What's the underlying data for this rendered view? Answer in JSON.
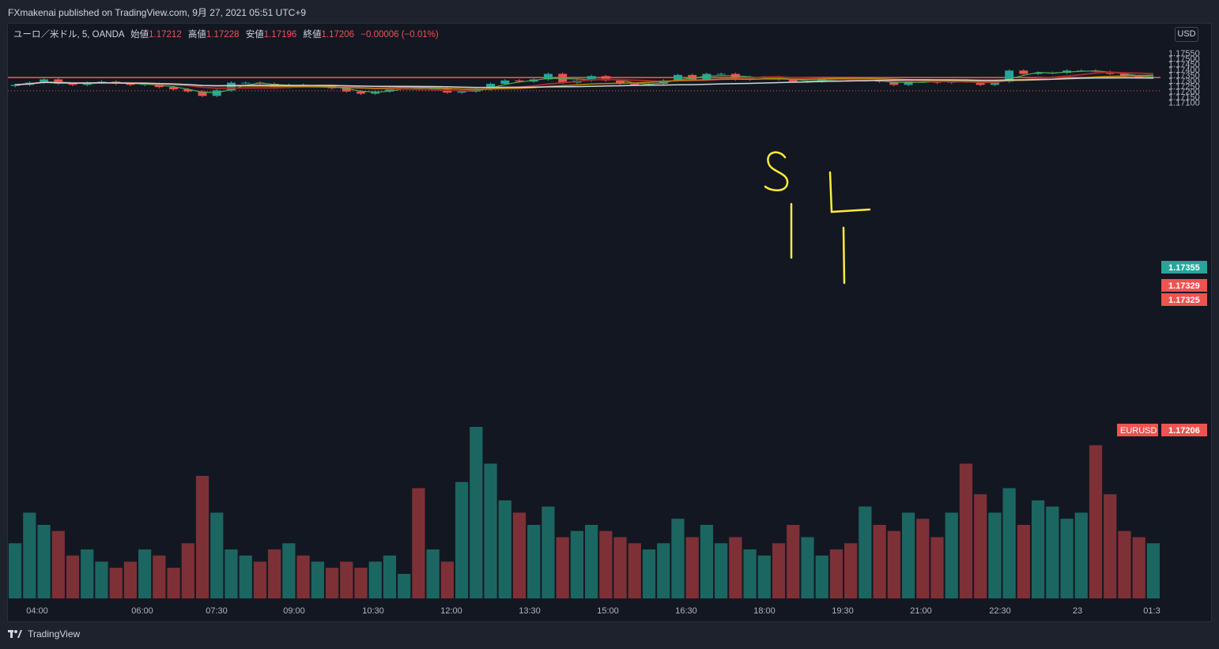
{
  "header": {
    "publisher": "FXmakenai published on TradingView.com, 9月 27, 2021 05:51 UTC+9"
  },
  "legend": {
    "symbol": "ユーロ／米ドル, 5, OANDA",
    "open_label": "始値",
    "open": "1.17212",
    "high_label": "高値",
    "high": "1.17228",
    "low_label": "安値",
    "low": "1.17196",
    "close_label": "終値",
    "close": "1.17206",
    "change": "−0.00006 (−0.01%)"
  },
  "currency_button": "USD",
  "price_tags": [
    {
      "value": "1.17355",
      "color": "#26a69a"
    },
    {
      "value": "1.17329",
      "color": "#ef5350"
    },
    {
      "value": "1.17325",
      "color": "#ef5350"
    }
  ],
  "last_price": {
    "symbol": "EURUSD",
    "value": "1.17206",
    "color": "#ef5350"
  },
  "annotations": [
    "S",
    "L"
  ],
  "footer": {
    "brand": "TradingView"
  },
  "chart_data": {
    "type": "candlestick",
    "symbol": "EURUSD",
    "timeframe": "5",
    "y_tick_labels": [
      "1.17550",
      "1.17500",
      "1.17450",
      "1.17400",
      "1.17350",
      "1.17300",
      "1.17250",
      "1.17200",
      "1.17150",
      "1.17100"
    ],
    "ylim": [
      1.1705,
      1.1757
    ],
    "x_tick_labels": [
      "04:00",
      "06:00",
      "07:30",
      "09:00",
      "10:30",
      "12:00",
      "13:30",
      "15:00",
      "16:30",
      "18:00",
      "19:30",
      "21:00",
      "22:30",
      "23",
      "01:3"
    ],
    "horizontal_lines": [
      1.17329,
      1.17325
    ],
    "close_series": [
      1.1726,
      1.1728,
      1.1731,
      1.1727,
      1.1726,
      1.1728,
      1.1729,
      1.1727,
      1.1726,
      1.1727,
      1.1724,
      1.1722,
      1.172,
      1.1716,
      1.1721,
      1.1728,
      1.1728,
      1.1727,
      1.1724,
      1.1726,
      1.1725,
      1.1725,
      1.1723,
      1.172,
      1.1718,
      1.172,
      1.1723,
      1.1724,
      1.1722,
      1.1723,
      1.1719,
      1.172,
      1.1722,
      1.1727,
      1.173,
      1.1729,
      1.1731,
      1.1736,
      1.1728,
      1.173,
      1.1734,
      1.173,
      1.1727,
      1.1726,
      1.1727,
      1.173,
      1.1735,
      1.1731,
      1.1736,
      1.1736,
      1.1731,
      1.1733,
      1.1733,
      1.1731,
      1.1729,
      1.1729,
      1.1732,
      1.1731,
      1.173,
      1.173,
      1.1729,
      1.1726,
      1.173,
      1.1729,
      1.1728,
      1.173,
      1.1729,
      1.1726,
      1.1729,
      1.1739,
      1.1736,
      1.1737,
      1.1737,
      1.1739,
      1.1739,
      1.1738,
      1.1736,
      1.1734,
      1.1733,
      1.1733
    ],
    "volume_series": [
      45,
      70,
      60,
      55,
      35,
      40,
      30,
      25,
      30,
      40,
      35,
      25,
      45,
      100,
      70,
      40,
      35,
      30,
      40,
      45,
      35,
      30,
      25,
      30,
      25,
      30,
      35,
      20,
      90,
      40,
      30,
      95,
      140,
      110,
      80,
      70,
      60,
      75,
      50,
      55,
      60,
      55,
      50,
      45,
      40,
      45,
      65,
      50,
      60,
      45,
      50,
      40,
      35,
      45,
      60,
      50,
      35,
      40,
      45,
      75,
      60,
      55,
      70,
      65,
      50,
      70,
      110,
      85,
      70,
      90,
      60,
      80,
      75,
      65,
      70,
      125,
      85,
      55,
      50,
      45
    ]
  }
}
